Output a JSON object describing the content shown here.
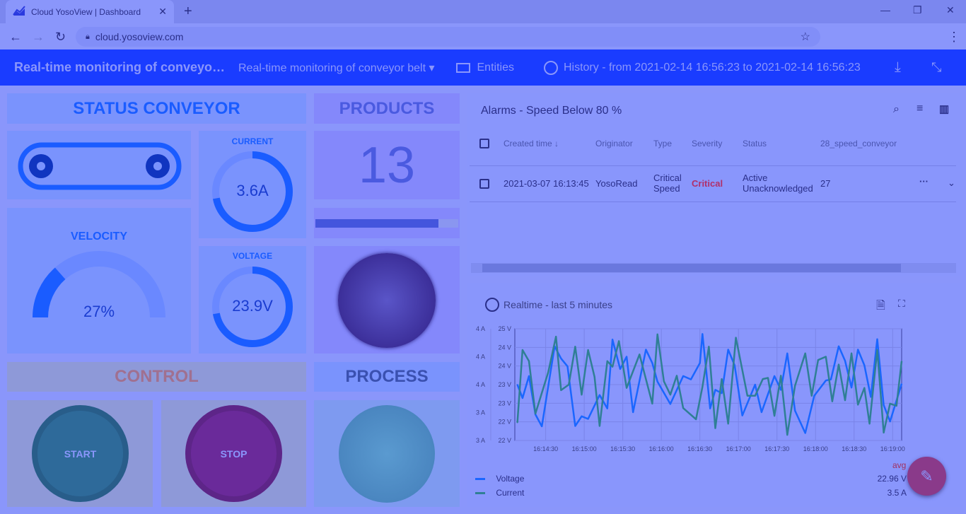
{
  "browser": {
    "tab_title": "Cloud YosoView | Dashboard",
    "url": "cloud.yosoview.com"
  },
  "header": {
    "title": "Real-time monitoring of conveyor belt",
    "dashboard_select": "Real-time monitoring of conveyor belt",
    "entities_label": "Entities",
    "history_label": "History - from 2021-02-14 16:56:23 to 2021-02-14 16:56:23"
  },
  "status": {
    "title": "STATUS CONVEYOR",
    "current_label": "CURRENT",
    "current_value": "3.6A",
    "current_fraction": 0.72,
    "voltage_label": "VOLTAGE",
    "voltage_value": "23.9V",
    "voltage_fraction": 0.72,
    "velocity_label": "VELOCITY",
    "velocity_value": "27%",
    "velocity_percent": 27
  },
  "products": {
    "title": "PRODUCTS",
    "count": "13",
    "progress_fraction": 0.86
  },
  "control": {
    "title": "CONTROL",
    "start_label": "START",
    "stop_label": "STOP"
  },
  "process": {
    "title": "PROCESS"
  },
  "alarms": {
    "title": "Alarms - Speed Below 80 %",
    "columns": [
      "Created time",
      "Originator",
      "Type",
      "Severity",
      "Status",
      "28_speed_conveyor"
    ],
    "rows": [
      {
        "created": "2021-03-07 16:13:45",
        "originator": "YosoRead",
        "type": "Critical Speed",
        "severity": "Critical",
        "status": "Active Unacknowledged",
        "value": "27"
      }
    ]
  },
  "realtime": {
    "title": "Realtime - last 5 minutes",
    "avg_label": "avg",
    "legend": [
      {
        "name": "Voltage",
        "avg": "22.96 V",
        "color": "#1a66ff"
      },
      {
        "name": "Current",
        "avg": "3.5 A",
        "color": "#2f7f95"
      }
    ]
  },
  "colors": {
    "header": "#1a3cff",
    "accent": "#1a5cff",
    "critical": "#b0306a",
    "fab": "#8a3a8a"
  },
  "chart_data": {
    "type": "line",
    "title": "Realtime - last 5 minutes",
    "grid": true,
    "legend_placement": "bottom",
    "x_range": [
      "16:14:06",
      "16:19:07"
    ],
    "x_ticks": [
      "16:14:30",
      "16:15:00",
      "16:15:30",
      "16:16:00",
      "16:16:30",
      "16:17:00",
      "16:17:30",
      "16:18:00",
      "16:18:30",
      "16:19:00"
    ],
    "y_left_ticks": [
      "4 A",
      "4 A",
      "4 A",
      "3 A",
      "3 A"
    ],
    "y_left_range": [
      3,
      4
    ],
    "y_right_ticks": [
      "25 V",
      "24 V",
      "24 V",
      "23 V",
      "23 V",
      "22 V",
      "22 V"
    ],
    "y_right_range": [
      22,
      25
    ],
    "series": [
      {
        "name": "Voltage",
        "axis": "V",
        "x": [
          "16:14:08",
          "16:14:12",
          "16:14:17",
          "16:14:22",
          "16:14:27",
          "16:14:37",
          "16:14:42",
          "16:14:47",
          "16:14:53",
          "16:14:58",
          "16:15:03",
          "16:15:12",
          "16:15:18",
          "16:15:22",
          "16:15:28",
          "16:15:33",
          "16:15:38",
          "16:15:48",
          "16:15:53",
          "16:15:57",
          "16:16:07",
          "16:16:17",
          "16:16:23",
          "16:16:30",
          "16:16:32",
          "16:16:38",
          "16:16:42",
          "16:16:47",
          "16:16:52",
          "16:16:57",
          "16:17:03",
          "16:17:13",
          "16:17:18",
          "16:17:28",
          "16:17:33",
          "16:17:38",
          "16:17:44",
          "16:17:52",
          "16:17:59",
          "16:18:08",
          "16:18:12",
          "16:18:18",
          "16:18:23",
          "16:18:28",
          "16:18:33",
          "16:18:38",
          "16:18:43",
          "16:18:48",
          "16:18:53",
          "16:18:58",
          "16:19:07"
        ],
        "y": [
          23.5,
          23.14,
          23.73,
          22.7,
          22.38,
          24.53,
          24.2,
          23.99,
          22.39,
          22.65,
          22.58,
          23.22,
          22.86,
          24.71,
          23.92,
          24.25,
          22.76,
          24.44,
          24.08,
          23.58,
          22.98,
          23.73,
          23.64,
          24.08,
          24.86,
          22.86,
          23.36,
          23.27,
          24.44,
          24.02,
          22.67,
          23.5,
          22.76,
          23.73,
          23.36,
          24.34,
          22.8,
          22.2,
          23.2,
          23.61,
          23.64,
          24.53,
          24.14,
          23.42,
          24.44,
          24.02,
          23.17,
          24.72,
          22.95,
          22.51,
          23.52
        ]
      },
      {
        "name": "Current",
        "axis": "A",
        "x": [
          "16:14:08",
          "16:14:12",
          "16:14:17",
          "16:14:22",
          "16:14:32",
          "16:14:38",
          "16:14:42",
          "16:14:48",
          "16:14:53",
          "16:14:58",
          "16:15:03",
          "16:15:08",
          "16:15:12",
          "16:15:18",
          "16:15:22",
          "16:15:27",
          "16:15:33",
          "16:15:43",
          "16:15:53",
          "16:15:57",
          "16:16:02",
          "16:16:07",
          "16:16:12",
          "16:16:17",
          "16:16:27",
          "16:16:32",
          "16:16:37",
          "16:16:42",
          "16:16:47",
          "16:16:52",
          "16:16:58",
          "16:17:07",
          "16:17:13",
          "16:17:19",
          "16:17:23",
          "16:17:28",
          "16:17:33",
          "16:17:38",
          "16:17:44",
          "16:17:52",
          "16:17:57",
          "16:18:02",
          "16:18:08",
          "16:18:13",
          "16:18:18",
          "16:18:23",
          "16:18:28",
          "16:18:33",
          "16:18:38",
          "16:18:42",
          "16:18:48",
          "16:18:53",
          "16:18:58",
          "16:19:03",
          "16:19:07"
        ],
        "y": [
          3.16,
          3.81,
          3.71,
          3.24,
          3.61,
          3.93,
          3.45,
          3.5,
          3.84,
          3.41,
          3.81,
          3.57,
          3.13,
          3.71,
          3.66,
          3.89,
          3.47,
          3.77,
          3.33,
          3.95,
          3.53,
          3.41,
          3.58,
          3.29,
          3.19,
          3.48,
          3.84,
          3.11,
          3.55,
          3.15,
          3.92,
          3.4,
          3.4,
          3.55,
          3.56,
          3.22,
          3.58,
          3.05,
          3.49,
          3.78,
          3.4,
          3.72,
          3.75,
          3.35,
          3.68,
          3.36,
          3.78,
          3.32,
          3.47,
          3.15,
          3.81,
          3.07,
          3.33,
          3.31,
          3.71
        ]
      }
    ]
  }
}
